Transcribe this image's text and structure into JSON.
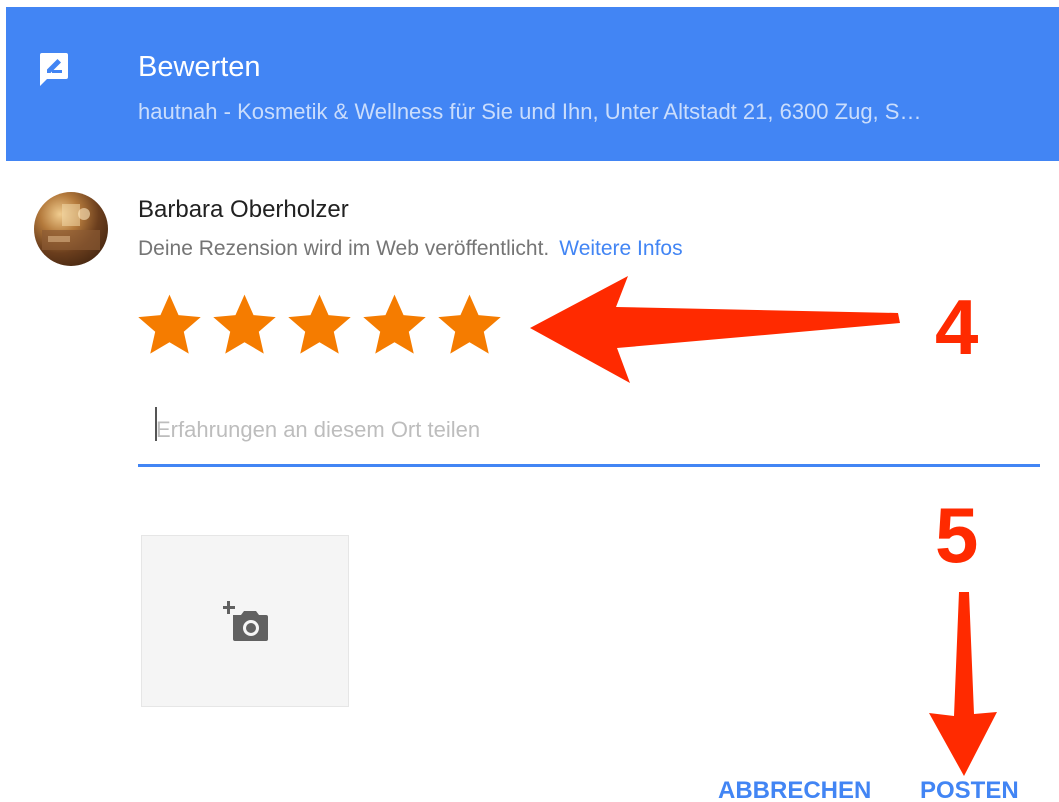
{
  "header": {
    "title": "Bewerten",
    "subtitle": "hautnah - Kosmetik & Wellness für Sie und Ihn, Unter Altstadt 21, 6300 Zug, S…",
    "icon": "rate-review-icon",
    "background_color": "#4285f4"
  },
  "user": {
    "name": "Barbara Oberholzer",
    "notice": "Deine Rezension wird im Web veröffentlicht.",
    "more_info_link": "Weitere Infos"
  },
  "rating": {
    "stars_selected": 5,
    "stars_total": 5,
    "star_color": "#f57c00"
  },
  "review": {
    "placeholder": "Erfahrungen an diesem Ort teilen",
    "value": ""
  },
  "photo": {
    "icon": "add-photo-icon"
  },
  "actions": {
    "cancel_label": "ABBRECHEN",
    "post_label": "POSTEN"
  },
  "annotations": {
    "step_4": "4",
    "step_5": "5",
    "color": "#ff2a00"
  }
}
